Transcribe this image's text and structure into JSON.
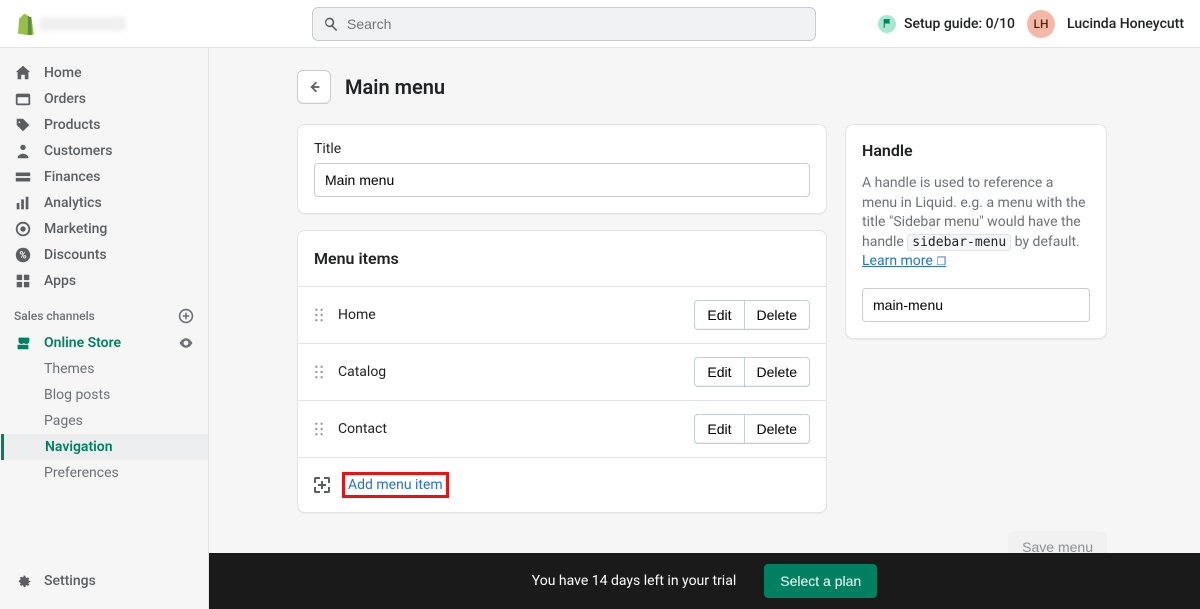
{
  "topbar": {
    "search_placeholder": "Search",
    "setup_guide_label": "Setup guide: 0/10",
    "avatar_initials": "LH",
    "user_name": "Lucinda Honeycutt"
  },
  "sidebar": {
    "items": [
      {
        "label": "Home"
      },
      {
        "label": "Orders"
      },
      {
        "label": "Products"
      },
      {
        "label": "Customers"
      },
      {
        "label": "Finances"
      },
      {
        "label": "Analytics"
      },
      {
        "label": "Marketing"
      },
      {
        "label": "Discounts"
      },
      {
        "label": "Apps"
      }
    ],
    "channels_label": "Sales channels",
    "channel_name": "Online Store",
    "subitems": [
      {
        "label": "Themes"
      },
      {
        "label": "Blog posts"
      },
      {
        "label": "Pages"
      },
      {
        "label": "Navigation"
      },
      {
        "label": "Preferences"
      }
    ],
    "settings_label": "Settings"
  },
  "page": {
    "title": "Main menu",
    "title_field_label": "Title",
    "title_field_value": "Main menu",
    "menu_items_heading": "Menu items",
    "menu_items": [
      {
        "label": "Home"
      },
      {
        "label": "Catalog"
      },
      {
        "label": "Contact"
      }
    ],
    "edit_label": "Edit",
    "delete_label": "Delete",
    "add_item_label": "Add menu item",
    "save_label": "Save menu"
  },
  "handle": {
    "heading": "Handle",
    "desc_pre": "A handle is used to reference a menu in Liquid. e.g. a menu with the title \"Sidebar menu\" would have the handle ",
    "code": "sidebar-menu",
    "desc_mid": " by default. ",
    "learn_more": "Learn more",
    "value": "main-menu"
  },
  "trial": {
    "text": "You have 14 days left in your trial",
    "button": "Select a plan"
  }
}
